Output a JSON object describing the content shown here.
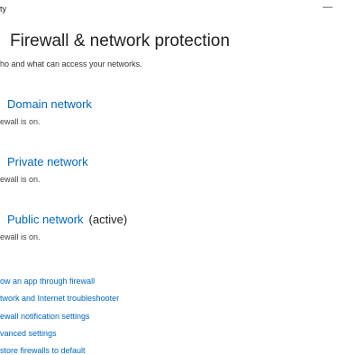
{
  "window": {
    "title_fragment": "ty",
    "minimize_glyph": "—"
  },
  "header": {
    "icon_glyph": ")",
    "title": "Firewall & network protection",
    "subtitle": "ho and what can access your networks."
  },
  "networks": [
    {
      "name": "Domain network",
      "status": "ewall is on.",
      "active": ""
    },
    {
      "name": "Private network",
      "status": "ewall is on.",
      "active": ""
    },
    {
      "name": "Public network",
      "status": "ewall is on.",
      "active": "(active)"
    }
  ],
  "links": [
    "ow an app through firewall",
    "twork and Internet troubleshooter",
    "ewall notification settings",
    "vanced settings",
    "store firewalls to default"
  ],
  "colors": {
    "link": "#0067c0",
    "text": "#1f1f1f",
    "background": "#ffffff"
  }
}
